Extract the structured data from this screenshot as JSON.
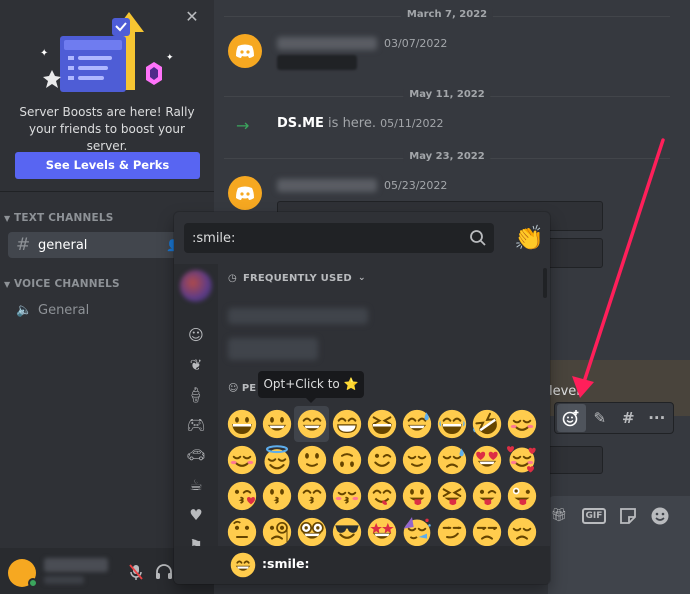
{
  "boost": {
    "text": "Server Boosts are here! Rally your friends to boost your server.",
    "button": "See Levels & Perks"
  },
  "channels": {
    "text_category": "TEXT CHANNELS",
    "text_items": [
      {
        "label": "general"
      }
    ],
    "voice_category": "VOICE CHANNELS",
    "voice_items": [
      {
        "label": "General"
      }
    ]
  },
  "messages": {
    "dates": [
      "March 7, 2022",
      "May 11, 2022",
      "May 23, 2022"
    ],
    "msg1_time": "03/07/2022",
    "join_name": "DS.ME",
    "join_suffix": " is here.",
    "join_time": "05/11/2022",
    "msg2_time": "05/23/2022",
    "level_text": "level"
  },
  "picker": {
    "search_value": ":smile:",
    "frequently_used": "FREQUENTLY USED",
    "people_label": "PE",
    "tooltip": "Opt+Click to ⭐",
    "footer_label": ":smile:",
    "emojis": [
      "grinning",
      "smiley",
      "smile",
      "grin",
      "laughing",
      "sweat_smile",
      "joy",
      "rofl",
      "relaxed",
      "blush",
      "innocent",
      "slight_smile",
      "upside_down",
      "wink",
      "relieved",
      "sweat",
      "heart_eyes",
      "smiling_hearts",
      "kissing_heart",
      "kissing",
      "kissing_smiling",
      "kissing_closed_eyes",
      "yum",
      "stuck_out_tongue",
      "stuck_out_tongue_closed_eyes",
      "stuck_out_tongue_winking_eye",
      "zany",
      "raised_eyebrow",
      "monocle",
      "nerd",
      "sunglasses",
      "star_struck",
      "partying",
      "smirk",
      "unamused",
      "disappointed"
    ]
  },
  "colors": {
    "blurple": "#5865f2",
    "emoji_yellow": "#ffcc4d",
    "annotation_arrow": "#ff1f5a",
    "online": "#3ba55d"
  }
}
